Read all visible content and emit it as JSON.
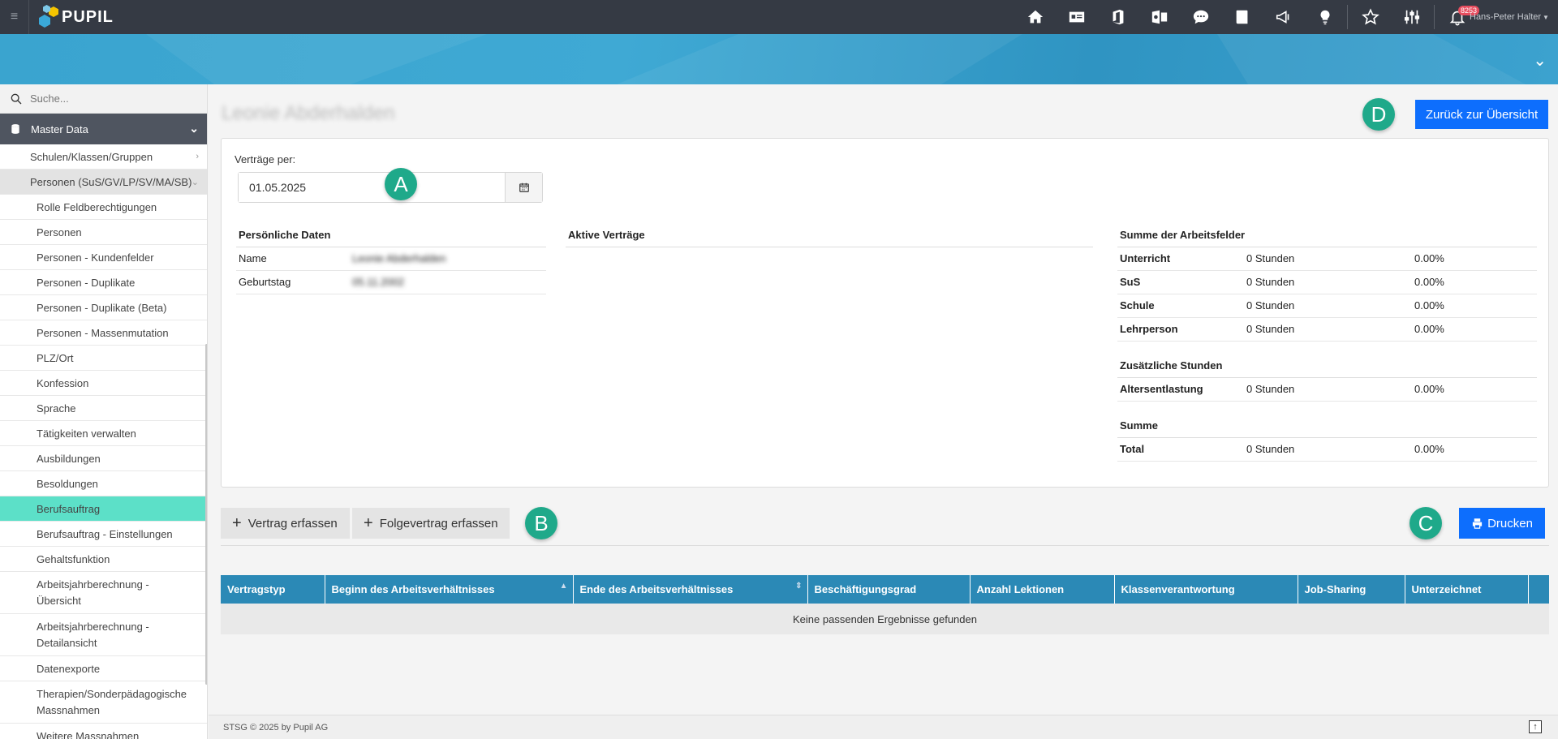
{
  "topbar": {
    "logo_text": "PUPIL",
    "user_name": "Hans-Peter Halter",
    "notification_count": "8253",
    "icons": [
      "home-icon",
      "contact-card-icon",
      "office-icon",
      "outlook-icon",
      "chat-icon",
      "book-icon",
      "megaphone-icon",
      "lightbulb-icon",
      "star-icon",
      "sliders-icon",
      "bell-icon"
    ]
  },
  "sidebar": {
    "search_placeholder": "Suche...",
    "section": "Master Data",
    "items": [
      {
        "label": "Schulen/Klassen/Gruppen"
      },
      {
        "label": "Personen (SuS/GV/LP/SV/MA/SB)"
      },
      {
        "label": "Rolle Feldberechtigungen"
      },
      {
        "label": "Personen"
      },
      {
        "label": "Personen - Kundenfelder"
      },
      {
        "label": "Personen - Duplikate"
      },
      {
        "label": "Personen - Duplikate (Beta)"
      },
      {
        "label": "Personen - Massenmutation"
      },
      {
        "label": "PLZ/Ort"
      },
      {
        "label": "Konfession"
      },
      {
        "label": "Sprache"
      },
      {
        "label": "Tätigkeiten verwalten"
      },
      {
        "label": "Ausbildungen"
      },
      {
        "label": "Besoldungen"
      },
      {
        "label": "Berufsauftrag"
      },
      {
        "label": "Berufsauftrag - Einstellungen"
      },
      {
        "label": "Gehaltsfunktion"
      },
      {
        "label": "Arbeitsjahrberechnung - Übersicht"
      },
      {
        "label": "Arbeitsjahrberechnung - Detailansicht"
      },
      {
        "label": "Datenexporte"
      },
      {
        "label": "Therapien/Sonderpädagogische Massnahmen"
      },
      {
        "label": "Weitere Massnahmen"
      }
    ]
  },
  "main": {
    "person_name": "Leonie Abderhalden",
    "back_button": "Zurück zur Übersicht",
    "markers": {
      "a": "A",
      "b": "B",
      "c": "C",
      "d": "D"
    },
    "contracts_label": "Verträge per:",
    "contracts_date": "01.05.2025",
    "personal": {
      "title": "Persönliche Daten",
      "rows": [
        {
          "label": "Name",
          "value": "Leonie Abderhalden"
        },
        {
          "label": "Geburtstag",
          "value": "05.11.2002"
        }
      ]
    },
    "active_contracts_title": "Aktive Verträge",
    "summary": {
      "title": "Summe der Arbeitsfelder",
      "rows": [
        {
          "label": "Unterricht",
          "hours": "0 Stunden",
          "pct": "0.00%"
        },
        {
          "label": "SuS",
          "hours": "0 Stunden",
          "pct": "0.00%"
        },
        {
          "label": "Schule",
          "hours": "0 Stunden",
          "pct": "0.00%"
        },
        {
          "label": "Lehrperson",
          "hours": "0 Stunden",
          "pct": "0.00%"
        }
      ],
      "extra_title": "Zusätzliche Stunden",
      "extra_rows": [
        {
          "label": "Altersentlastung",
          "hours": "0 Stunden",
          "pct": "0.00%"
        }
      ],
      "total_title": "Summe",
      "total_row": {
        "label": "Total",
        "hours": "0 Stunden",
        "pct": "0.00%"
      }
    },
    "btn_add_contract": "Vertrag erfassen",
    "btn_add_followup": "Folgevertrag erfassen",
    "btn_print": "Drucken",
    "grid": {
      "columns": [
        "Vertragstyp",
        "Beginn des Arbeitsverhältnisses",
        "Ende des Arbeitsverhältnisses",
        "Beschäftigungsgrad",
        "Anzahl Lektionen",
        "Klassenverantwortung",
        "Job-Sharing",
        "Unterzeichnet"
      ],
      "empty_text": "Keine passenden Ergebnisse gefunden"
    }
  },
  "footer": {
    "text": "STSG © 2025 by Pupil AG"
  }
}
